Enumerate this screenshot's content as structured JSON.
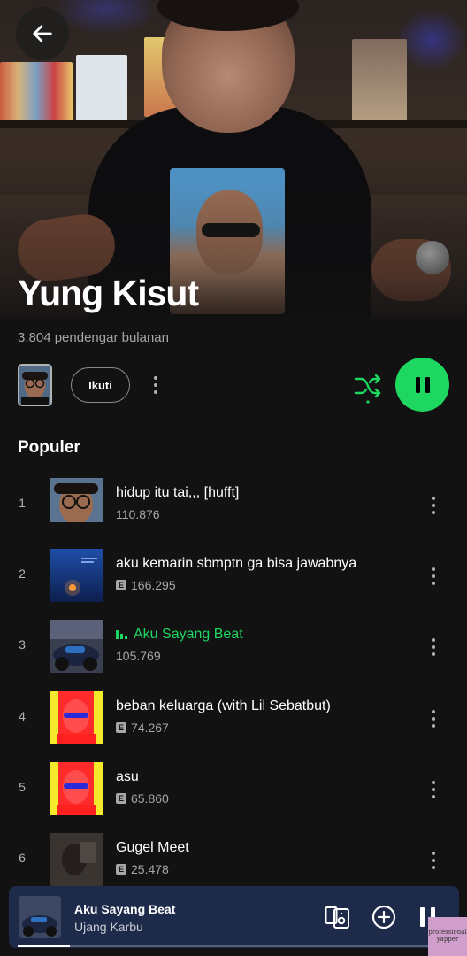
{
  "hero": {
    "artist_name": "Yung Kisut",
    "listeners": "3.804 pendengar bulanan"
  },
  "actions": {
    "follow_label": "Ikuti"
  },
  "section": {
    "popular_title": "Populer"
  },
  "tracks": [
    {
      "num": "1",
      "title": "hidup itu tai,,, [hufft]",
      "plays": "110.876",
      "explicit": false,
      "playing": false
    },
    {
      "num": "2",
      "title": "aku kemarin sbmptn ga bisa jawabnya",
      "plays": "166.295",
      "explicit": true,
      "playing": false
    },
    {
      "num": "3",
      "title": "Aku Sayang Beat",
      "plays": "105.769",
      "explicit": false,
      "playing": true
    },
    {
      "num": "4",
      "title": "beban keluarga (with Lil Sebatbut)",
      "plays": "74.267",
      "explicit": true,
      "playing": false
    },
    {
      "num": "5",
      "title": "asu",
      "plays": "65.860",
      "explicit": true,
      "playing": false
    },
    {
      "num": "6",
      "title": "Gugel Meet",
      "plays": "25.478",
      "explicit": true,
      "playing": false
    }
  ],
  "explicit_badge": "E",
  "mini_player": {
    "title": "Aku Sayang Beat",
    "artist": "Ujang Karbu",
    "progress": 0.12
  },
  "watermark": "professional yapper",
  "colors": {
    "accent": "#1ed760",
    "background": "#121212",
    "mini_player_bg": "#1e2a4a",
    "secondary_text": "#a7a7a7"
  },
  "icons": [
    "arrow-left-icon",
    "more-vertical-icon",
    "shuffle-icon",
    "pause-icon",
    "devices-icon",
    "add-circle-icon",
    "equalizer-icon"
  ]
}
